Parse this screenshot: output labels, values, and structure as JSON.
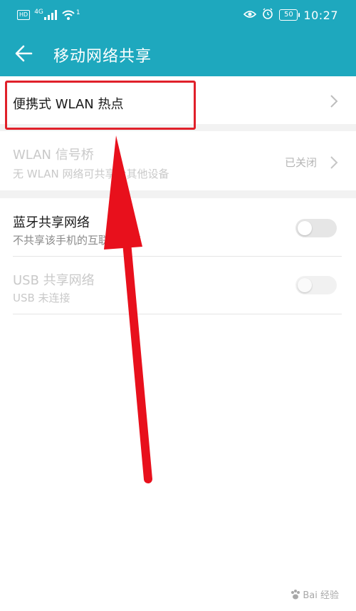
{
  "status_bar": {
    "left_icons": [
      "hd-voice-icon",
      "4g-signal-icon",
      "wifi-signal-icon"
    ],
    "hd_label": "HD",
    "network_label": "4G",
    "wifi_label": "1",
    "battery_level": "50",
    "time": "10:27"
  },
  "app_bar": {
    "title": "移动网络共享",
    "back_icon": "back-arrow-icon"
  },
  "settings": {
    "hotspot": {
      "title": "便携式 WLAN 热点"
    },
    "wlan_bridge": {
      "title": "WLAN 信号桥",
      "subtitle": "无 WLAN 网络可共享给其他设备",
      "value": "已关闭"
    },
    "bluetooth": {
      "title": "蓝牙共享网络",
      "subtitle": "不共享该手机的互联网连接",
      "enabled": false
    },
    "usb": {
      "title": "USB 共享网络",
      "subtitle": "USB 未连接",
      "enabled": false
    }
  },
  "annotation": {
    "highlight_color": "#e0202a",
    "arrow_color": "#e8101c"
  },
  "watermark": {
    "text": "Bai 经验"
  },
  "colors": {
    "accent": "#1ea8be",
    "background": "#ffffff",
    "section_gap": "#f2f2f2"
  }
}
